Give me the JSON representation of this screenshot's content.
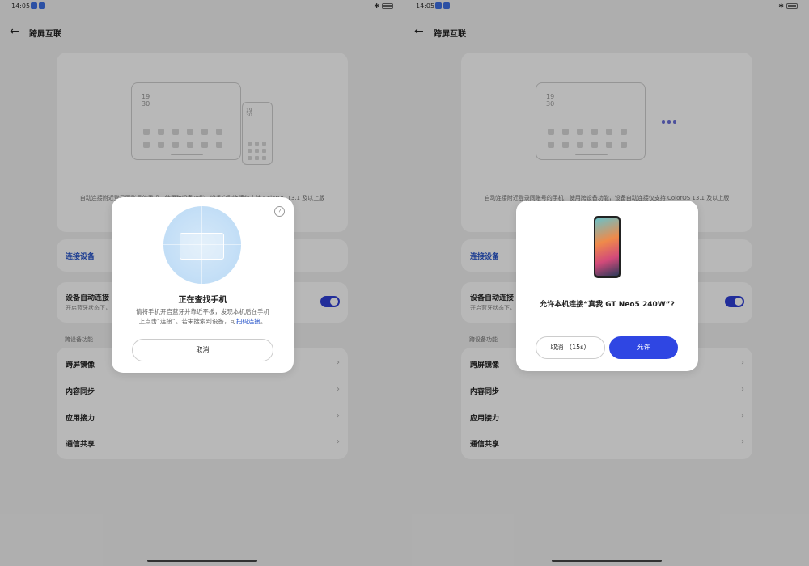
{
  "status": {
    "time": "14:05"
  },
  "header": {
    "title": "跨屏互联",
    "back_label": "←"
  },
  "hero": {
    "tablet_time": "19\n30",
    "phone_time": "19\n30",
    "description": "自动连接附近登录同账号的手机，使用跨设备功能，设备自动连接仅支持 ColorOS 13.1 及以上版"
  },
  "connect_device": {
    "label": "连接设备"
  },
  "auto_connect": {
    "title": "设备自动连接",
    "subtitle": "开启蓝牙状态下，",
    "enabled": true
  },
  "section": {
    "title": "跨设备功能"
  },
  "features": [
    {
      "label": "跨屏镜像"
    },
    {
      "label": "内容同步"
    },
    {
      "label": "应用接力"
    },
    {
      "label": "通信共享"
    }
  ],
  "searching_dialog": {
    "help_icon": "?",
    "title": "正在查找手机",
    "desc_line1": "请将手机开启蓝牙并靠近平板，发现本机后在手机",
    "desc_line2": "上点击“连接”。若未搜索到设备，可",
    "scan_link": "扫码连接",
    "desc_end": "。",
    "cancel": "取消"
  },
  "allow_dialog": {
    "title": "允许本机连接“真我 GT Neo5 240W”?",
    "cancel": "取消  （15s）",
    "allow": "允许"
  },
  "colors": {
    "accent": "#2f46e3",
    "link": "#2452c9"
  }
}
